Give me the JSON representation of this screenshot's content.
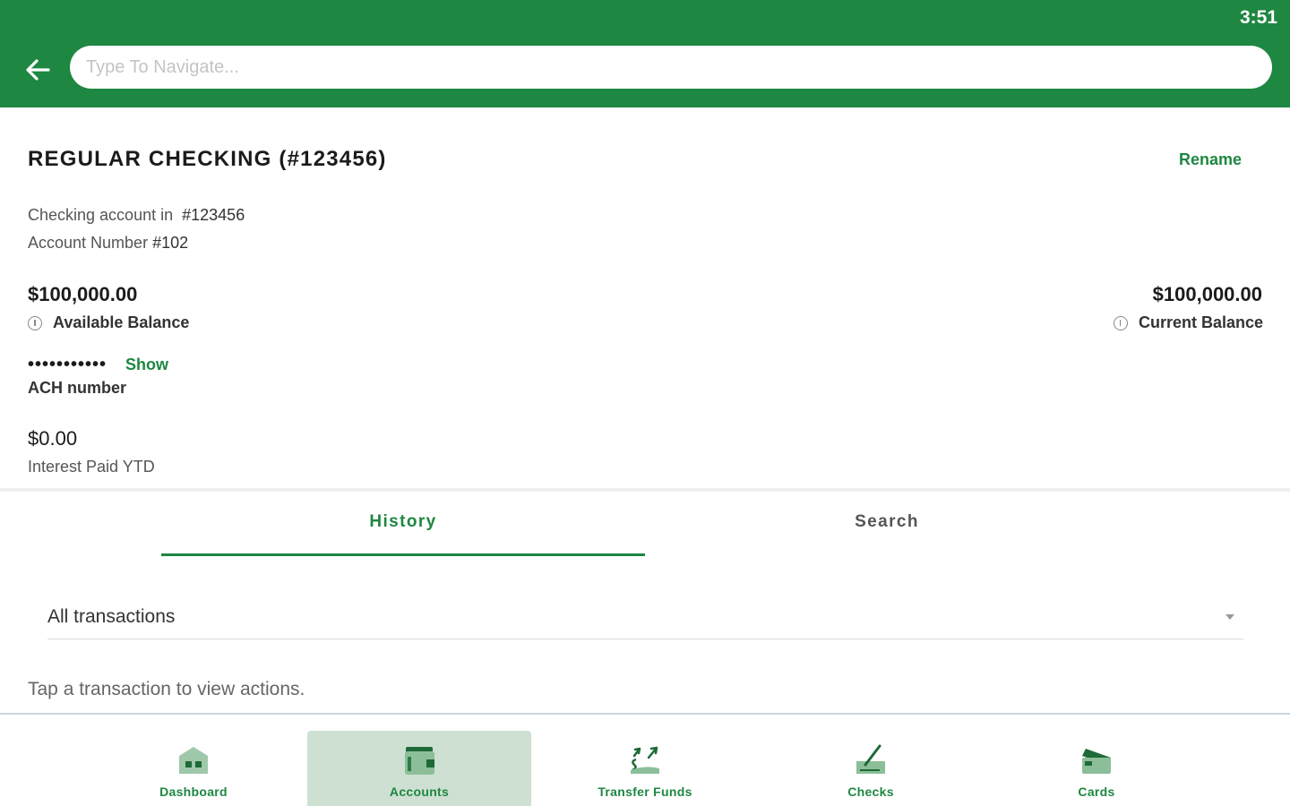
{
  "status": {
    "time": "3:51"
  },
  "header": {
    "search_placeholder": "Type To Navigate..."
  },
  "account": {
    "title": "REGULAR CHECKING (#123456)",
    "rename_label": "Rename",
    "checking_line_prefix": "Checking account in",
    "checking_line_number": "#123456",
    "account_number_prefix": "Account Number",
    "account_number_value": "#102",
    "available_amount": "$100,000.00",
    "available_label": "Available Balance",
    "current_amount": "$100,000.00",
    "current_label": "Current Balance",
    "ach_masked": "•••••••••••",
    "ach_show_label": "Show",
    "ach_label": "ACH number",
    "interest_amount": "$0.00",
    "interest_label": "Interest Paid YTD"
  },
  "tabs": [
    {
      "label": "History",
      "active": true
    },
    {
      "label": "Search",
      "active": false
    }
  ],
  "filter": {
    "selected": "All transactions"
  },
  "hint": "Tap a transaction to view actions.",
  "bottom_nav": [
    {
      "label": "Dashboard",
      "icon": "dashboard-icon",
      "active": false
    },
    {
      "label": "Accounts",
      "icon": "accounts-icon",
      "active": true
    },
    {
      "label": "Transfer Funds",
      "icon": "transfer-funds-icon",
      "active": false
    },
    {
      "label": "Checks",
      "icon": "checks-icon",
      "active": false
    },
    {
      "label": "Cards",
      "icon": "cards-icon",
      "active": false
    }
  ],
  "colors": {
    "brand_green": "#1e8741",
    "active_nav_bg": "#cde0d2"
  }
}
